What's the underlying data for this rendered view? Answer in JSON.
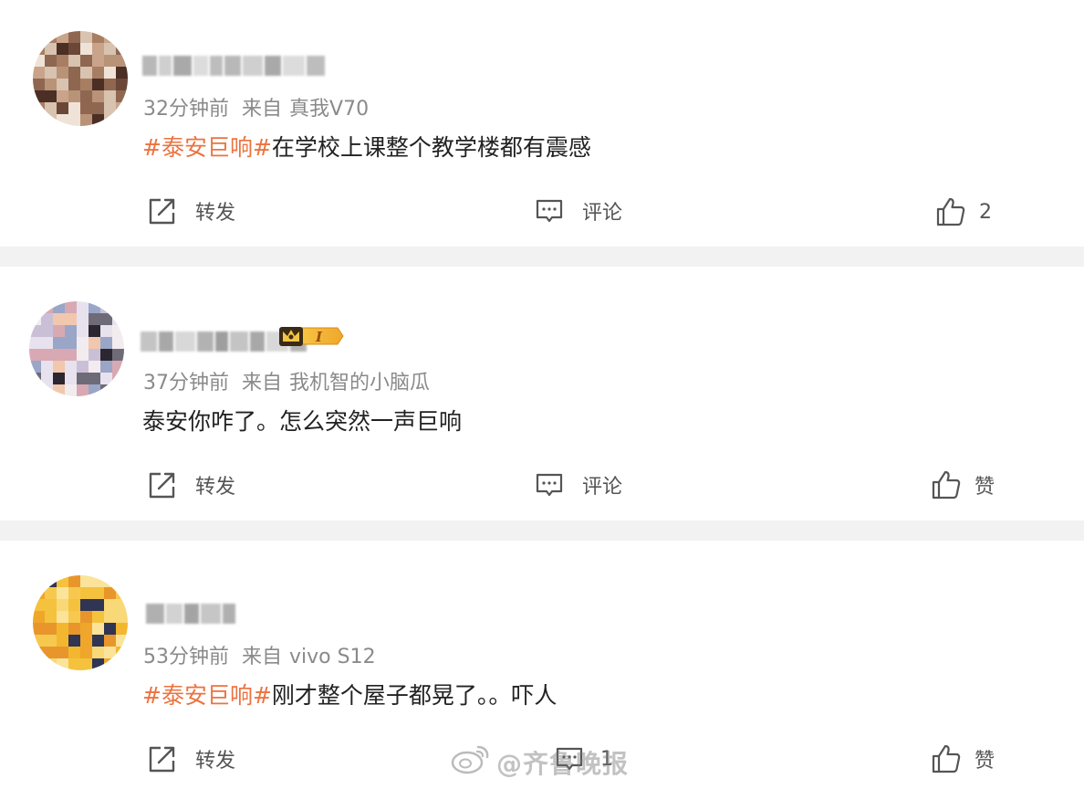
{
  "posts": [
    {
      "time": "32分钟前",
      "source_label": "来自",
      "source": "真我V70",
      "topic": "#泰安巨响#",
      "text": "在学校上课整个教学楼都有震感",
      "actions": {
        "repost": "转发",
        "comment": "评论",
        "like": "2"
      }
    },
    {
      "time": "37分钟前",
      "source_label": "来自",
      "source": "我机智的小脑瓜",
      "topic": "",
      "text": "泰安你咋了。怎么突然一声巨响",
      "badge": "I",
      "actions": {
        "repost": "转发",
        "comment": "评论",
        "like": "赞"
      }
    },
    {
      "time": "53分钟前",
      "source_label": "来自",
      "source": "vivo S12",
      "topic": "#泰安巨响#",
      "text": "刚才整个屋子都晃了。。吓人",
      "actions": {
        "repost": "转发",
        "comment": "1",
        "like": "赞"
      }
    }
  ],
  "watermark": "@齐鲁晚报",
  "colors": {
    "topic": "#eb7340",
    "meta": "#8a8a8a",
    "separator": "#f2f2f2"
  }
}
